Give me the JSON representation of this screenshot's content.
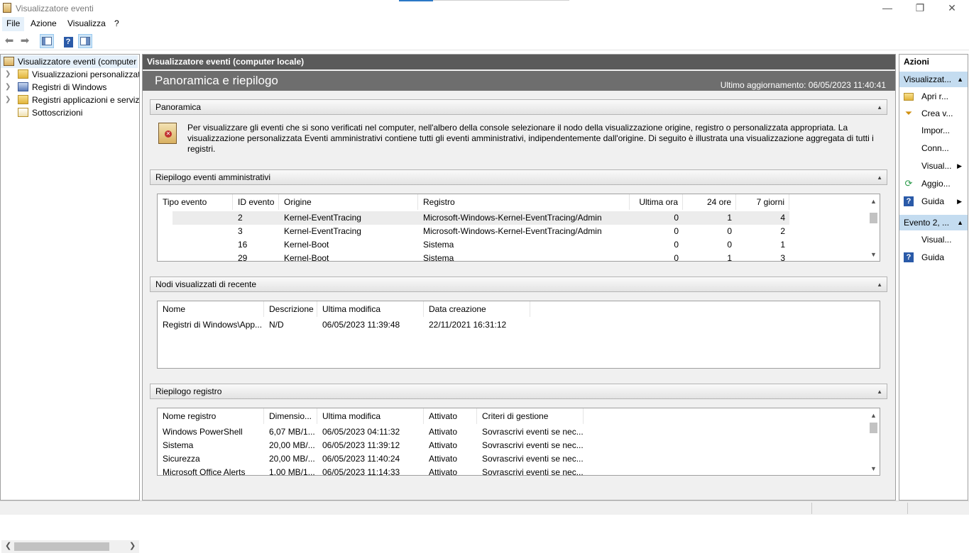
{
  "window": {
    "title": "Visualizzatore eventi",
    "minimize": "—",
    "restore": "❐",
    "close": "✕"
  },
  "menu": [
    "File",
    "Azione",
    "Visualizza",
    "?"
  ],
  "toolbar": {
    "back_icon": "arrow-left-icon",
    "forward_icon": "arrow-right-icon",
    "help_label": "?"
  },
  "tree": {
    "root": "Visualizzatore eventi (computer",
    "items": [
      "Visualizzazioni personalizzate",
      "Registri di Windows",
      "Registri applicazioni e servizi",
      "Sottoscrizioni"
    ]
  },
  "center": {
    "header": "Visualizzatore eventi (computer locale)",
    "banner_title": "Panoramica e riepilogo",
    "last_update": "Ultimo aggiornamento: 06/05/2023 11:40:41",
    "overview": {
      "title": "Panoramica",
      "text": "Per visualizzare gli eventi che si sono verificati nel computer, nell'albero della console selezionare il nodo della visualizzazione origine, registro o personalizzata appropriata. La visualizzazione personalizzata Eventi amministrativi contiene tutti gli eventi amministrativi, indipendentemente dall'origine. Di seguito è illustrata una visualizzazione aggregata di tutti i registri."
    },
    "admin_summary": {
      "title": "Riepilogo eventi amministrativi",
      "columns": [
        "Tipo evento",
        "ID evento",
        "Origine",
        "Registro",
        "Ultima ora",
        "24 ore",
        "7 giorni"
      ],
      "rows": [
        [
          "",
          "2",
          "Kernel-EventTracing",
          "Microsoft-Windows-Kernel-EventTracing/Admin",
          "0",
          "1",
          "4"
        ],
        [
          "",
          "3",
          "Kernel-EventTracing",
          "Microsoft-Windows-Kernel-EventTracing/Admin",
          "0",
          "0",
          "2"
        ],
        [
          "",
          "16",
          "Kernel-Boot",
          "Sistema",
          "0",
          "0",
          "1"
        ],
        [
          "",
          "29",
          "Kernel-Boot",
          "Sistema",
          "0",
          "1",
          "3"
        ]
      ]
    },
    "recent": {
      "title": "Nodi visualizzati di recente",
      "columns": [
        "Nome",
        "Descrizione",
        "Ultima modifica",
        "Data creazione"
      ],
      "rows": [
        [
          "Registri di Windows\\App...",
          "N/D",
          "06/05/2023 11:39:48",
          "22/11/2021 16:31:12"
        ]
      ]
    },
    "log_summary": {
      "title": "Riepilogo registro",
      "columns": [
        "Nome registro",
        "Dimensio...",
        "Ultima modifica",
        "Attivato",
        "Criteri di gestione"
      ],
      "rows": [
        [
          "Windows PowerShell",
          "6,07 MB/1...",
          "06/05/2023 04:11:32",
          "Attivato",
          "Sovrascrivi eventi se nec..."
        ],
        [
          "Sistema",
          "20,00 MB/...",
          "06/05/2023 11:39:12",
          "Attivato",
          "Sovrascrivi eventi se nec..."
        ],
        [
          "Sicurezza",
          "20,00 MB/...",
          "06/05/2023 11:40:24",
          "Attivato",
          "Sovrascrivi eventi se nec..."
        ],
        [
          "Microsoft Office Alerts",
          "1,00 MB/1...",
          "06/05/2023 11:14:33",
          "Attivato",
          "Sovrascrivi eventi se nec..."
        ]
      ]
    }
  },
  "actions": {
    "title": "Azioni",
    "group1": {
      "label": "Visualizzat...",
      "items": [
        {
          "label": "Apri r...",
          "icon": "folder-open-icon"
        },
        {
          "label": "Crea v...",
          "icon": "filter-icon"
        },
        {
          "label": "Impor...",
          "icon": ""
        },
        {
          "label": "Conn...",
          "icon": ""
        },
        {
          "label": "Visual...",
          "icon": "",
          "submenu": "▶"
        },
        {
          "label": "Aggio...",
          "icon": "refresh-icon"
        },
        {
          "label": "Guida",
          "icon": "help-icon",
          "submenu": "▶"
        }
      ]
    },
    "group2": {
      "label": "Evento 2, ...",
      "items": [
        {
          "label": "Visual...",
          "icon": ""
        },
        {
          "label": "Guida",
          "icon": "help-icon"
        }
      ]
    }
  }
}
